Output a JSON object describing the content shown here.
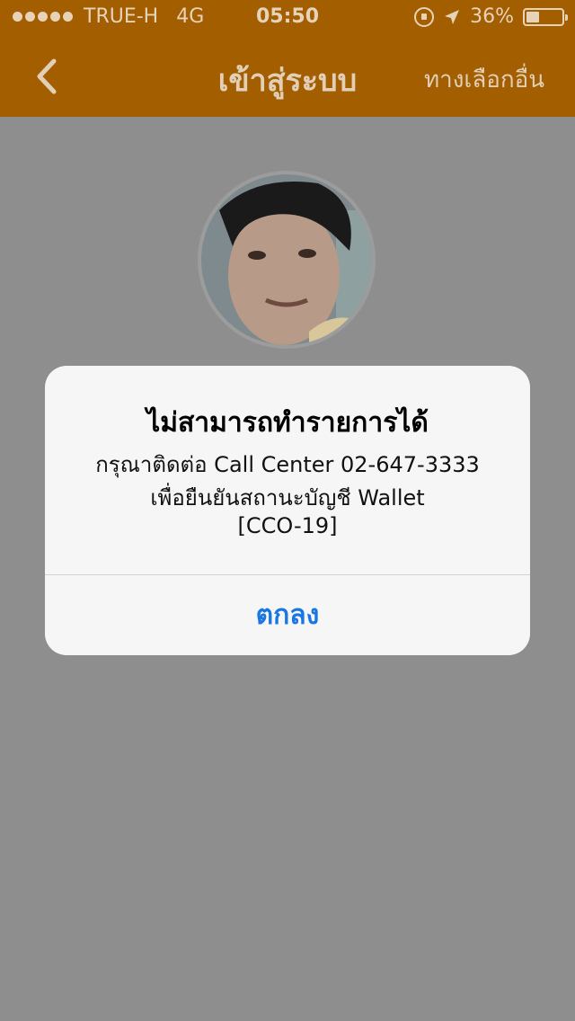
{
  "status_bar": {
    "carrier": "TRUE-H",
    "network": "4G",
    "time": "05:50",
    "battery": "36%",
    "battery_level": 0.36
  },
  "nav": {
    "title": "เข้าสู่ระบบ",
    "other_options": "ทางเลือกอื่น"
  },
  "alert": {
    "title": "ไม่สามารถทำรายการได้",
    "message_line1": "กรุณาติดต่อ Call Center 02-647-3333",
    "message_line2": "เพื่อยืนยันสถานะบัญชี Wallet",
    "message_line3": "[CCO-19]",
    "ok_button": "ตกลง"
  },
  "colors": {
    "nav_bg": "#a35e00",
    "dim_bg": "#8e8e8e",
    "alert_button": "#1976e2"
  }
}
